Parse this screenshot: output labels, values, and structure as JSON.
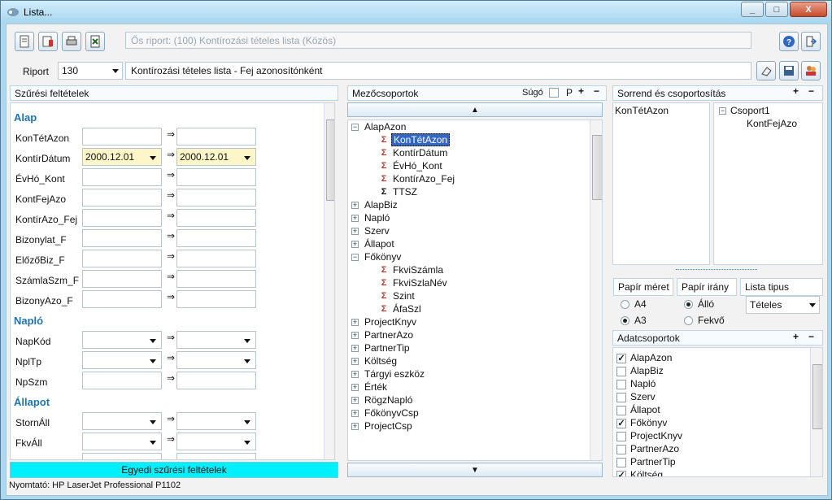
{
  "window": {
    "title": "Lista...",
    "min": "_",
    "max": "□",
    "close": "X"
  },
  "top": {
    "origin_text": "Ős riport: (100)  Kontírozási tételes lista (Közös)",
    "riport_label": "Riport",
    "riport_value": "130",
    "riport_name": "Kontírozási tételes lista - Fej azonosítónként"
  },
  "left": {
    "header": "Szűrési feltételek",
    "arrow": "⇒",
    "sections": {
      "alap": "Alap",
      "naplo": "Napló",
      "allapot": "Állapot"
    },
    "rows": {
      "r1": "KonTétAzon",
      "r2": "KontírDátum",
      "r2_from": "2000.12.01",
      "r2_to": "2000.12.01",
      "r3": "ÉvHó_Kont",
      "r4": "KontFejAzo",
      "r5": "KontírAzo_Fej",
      "r6": "Bizonylat_F",
      "r7": "ElőzőBiz_F",
      "r8": "SzámlaSzm_F",
      "r9": "BizonyAzo_F",
      "r10": "NapKód",
      "r11": "NplTp",
      "r12": "NpSzm",
      "r13": "StornÁll",
      "r14": "FkvÁll"
    },
    "bottom_button": "Egyedi szűrési feltételek"
  },
  "middle": {
    "header": "Mezőcsoportok",
    "help_label": "Súgó",
    "p_label": "P",
    "plus": "+",
    "minus": "−",
    "tree": [
      "AlapAzon",
      "KonTétAzon",
      "KontírDátum",
      "ÉvHó_Kont",
      "KontírAzo_Fej",
      "TTSZ",
      "AlapBiz",
      "Napló",
      "Szerv",
      "Állapot",
      "Főkönyv",
      "FkviSzámla",
      "FkviSzlaNév",
      "Szint",
      "ÁfaSzl",
      "ProjectKnyv",
      "PartnerAzo",
      "PartnerTip",
      "Költség",
      "Tárgyi eszköz",
      "Érték",
      "RögzNapló",
      "FőkönyvCsp",
      "ProjectCsp"
    ]
  },
  "right": {
    "header": "Sorrend és csoportosítás",
    "order_item": "KonTétAzon",
    "group": "Csoport1",
    "group_child": "KontFejAzo",
    "paper_size": "Papír méret",
    "paper_dir": "Papír irány",
    "list_type": "Lista tipus",
    "a4": "A4",
    "a3": "A3",
    "allo": "Álló",
    "fekvo": "Fekvő",
    "list_type_value": "Tételes",
    "data_groups_header": "Adatcsoportok",
    "data_groups": [
      {
        "label": "AlapAzon",
        "checked": true
      },
      {
        "label": "AlapBiz",
        "checked": false
      },
      {
        "label": "Napló",
        "checked": false
      },
      {
        "label": "Szerv",
        "checked": false
      },
      {
        "label": "Állapot",
        "checked": false
      },
      {
        "label": "Főkönyv",
        "checked": true
      },
      {
        "label": "ProjectKnyv",
        "checked": false
      },
      {
        "label": "PartnerAzo",
        "checked": false
      },
      {
        "label": "PartnerTip",
        "checked": false
      },
      {
        "label": "Költség",
        "checked": true
      }
    ]
  },
  "status": "Nyomtató: HP LaserJet Professional P1102",
  "colors": {
    "accent": "#1e73b5",
    "highlight": "#00f0ff",
    "selection": "#3166c6"
  }
}
